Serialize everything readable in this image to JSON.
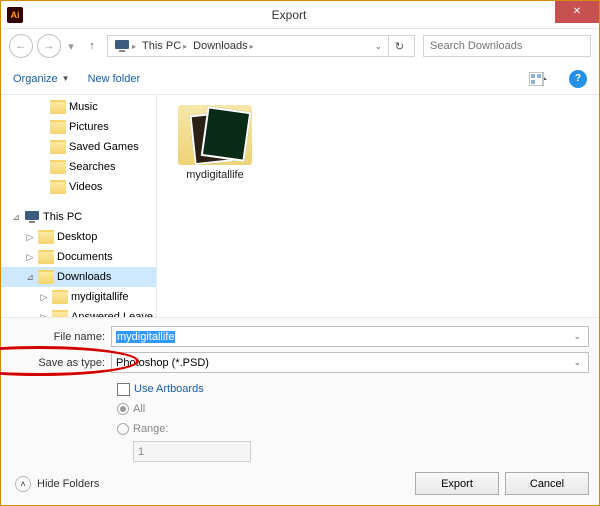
{
  "window": {
    "title": "Export",
    "app_icon_text": "Ai"
  },
  "breadcrumb": {
    "items": [
      "This PC",
      "Downloads"
    ],
    "search_placeholder": "Search Downloads"
  },
  "toolbar": {
    "organize": "Organize",
    "new_folder": "New folder"
  },
  "sidebar": {
    "items": [
      {
        "label": "Music",
        "indent": 36,
        "expander": "",
        "icon": "folder"
      },
      {
        "label": "Pictures",
        "indent": 36,
        "expander": "",
        "icon": "folder"
      },
      {
        "label": "Saved Games",
        "indent": 36,
        "expander": "",
        "icon": "folder"
      },
      {
        "label": "Searches",
        "indent": 36,
        "expander": "",
        "icon": "folder"
      },
      {
        "label": "Videos",
        "indent": 36,
        "expander": "",
        "icon": "folder"
      },
      {
        "label": "",
        "indent": 0,
        "expander": "",
        "icon": "empty"
      },
      {
        "label": "This PC",
        "indent": 10,
        "expander": "⊿",
        "icon": "pc"
      },
      {
        "label": "Desktop",
        "indent": 24,
        "expander": "▷",
        "icon": "folder"
      },
      {
        "label": "Documents",
        "indent": 24,
        "expander": "▷",
        "icon": "folder"
      },
      {
        "label": "Downloads",
        "indent": 24,
        "expander": "⊿",
        "icon": "folder",
        "selected": true
      },
      {
        "label": "mydigitallife",
        "indent": 38,
        "expander": "▷",
        "icon": "folder"
      },
      {
        "label": "Answered Leave",
        "indent": 38,
        "expander": "▷",
        "icon": "folder"
      }
    ]
  },
  "content": {
    "folder_name": "mydigitallife"
  },
  "filename": {
    "label": "File name:",
    "value": "mydigitallife"
  },
  "savetype": {
    "label": "Save as type:",
    "value": "Photoshop (*.PSD)"
  },
  "options": {
    "use_artboards": "Use Artboards",
    "all": "All",
    "range": "Range:",
    "range_value": "1"
  },
  "footer": {
    "hide_folders": "Hide Folders",
    "export": "Export",
    "cancel": "Cancel"
  }
}
